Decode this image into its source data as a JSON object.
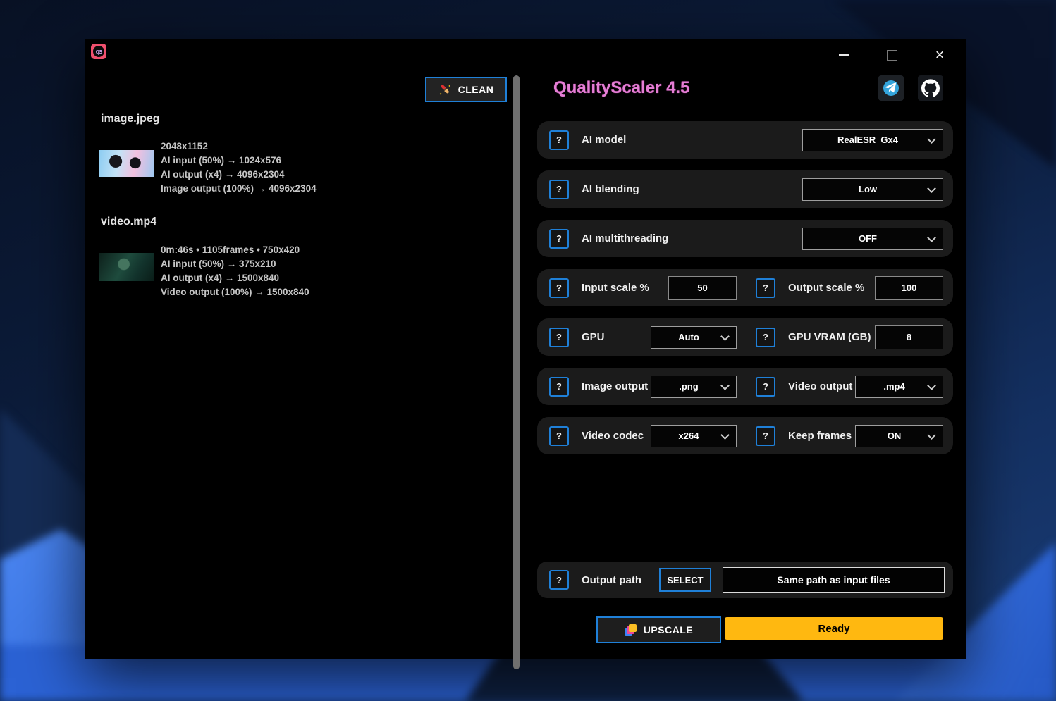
{
  "colors": {
    "accent_blue": "#1f80d8",
    "title_pink": "#e57ed5",
    "status_yellow": "#ffb810",
    "row_bg": "#1b1b1b"
  },
  "icons": {
    "app_logo": "qs",
    "clean": "paintbrush-sparkles",
    "telegram": "paper-plane",
    "github": "octocat",
    "upscale": "layered-squares",
    "minimize": "minimize-line",
    "maximize": "maximize-square",
    "close": "×",
    "help": "?",
    "dropdown_chevron": "chevron-down"
  },
  "titlebar": {
    "close": "×"
  },
  "header": {
    "app_title": "QualityScaler 4.5"
  },
  "left_panel": {
    "clean_button": "CLEAN",
    "files": [
      {
        "name": "image.jpeg",
        "lines": [
          "2048x1152",
          "AI input (50%) → 1024x576",
          "AI output (x4) → 4096x2304",
          "Image output (100%) → 4096x2304"
        ]
      },
      {
        "name": "video.mp4",
        "lines": [
          "0m:46s • 1105frames • 750x420",
          "AI input (50%) → 375x210",
          "AI output (x4) → 1500x840",
          "Video output (100%) → 1500x840"
        ]
      }
    ]
  },
  "settings": {
    "ai_model": {
      "label": "AI model",
      "value": "RealESR_Gx4"
    },
    "ai_blending": {
      "label": "AI blending",
      "value": "Low"
    },
    "ai_multithreading": {
      "label": "AI multithreading",
      "value": "OFF"
    },
    "input_scale": {
      "label": "Input scale %",
      "value": "50"
    },
    "output_scale": {
      "label": "Output scale %",
      "value": "100"
    },
    "gpu": {
      "label": "GPU",
      "value": "Auto"
    },
    "gpu_vram": {
      "label": "GPU VRAM (GB)",
      "value": "8"
    },
    "image_output": {
      "label": "Image output",
      "value": ".png"
    },
    "video_output": {
      "label": "Video output",
      "value": ".mp4"
    },
    "video_codec": {
      "label": "Video codec",
      "value": "x264"
    },
    "keep_frames": {
      "label": "Keep frames",
      "value": "ON"
    },
    "output_path": {
      "label": "Output path",
      "select_button": "SELECT",
      "value": "Same path as input files"
    }
  },
  "actions": {
    "upscale": "UPSCALE",
    "status": "Ready"
  }
}
